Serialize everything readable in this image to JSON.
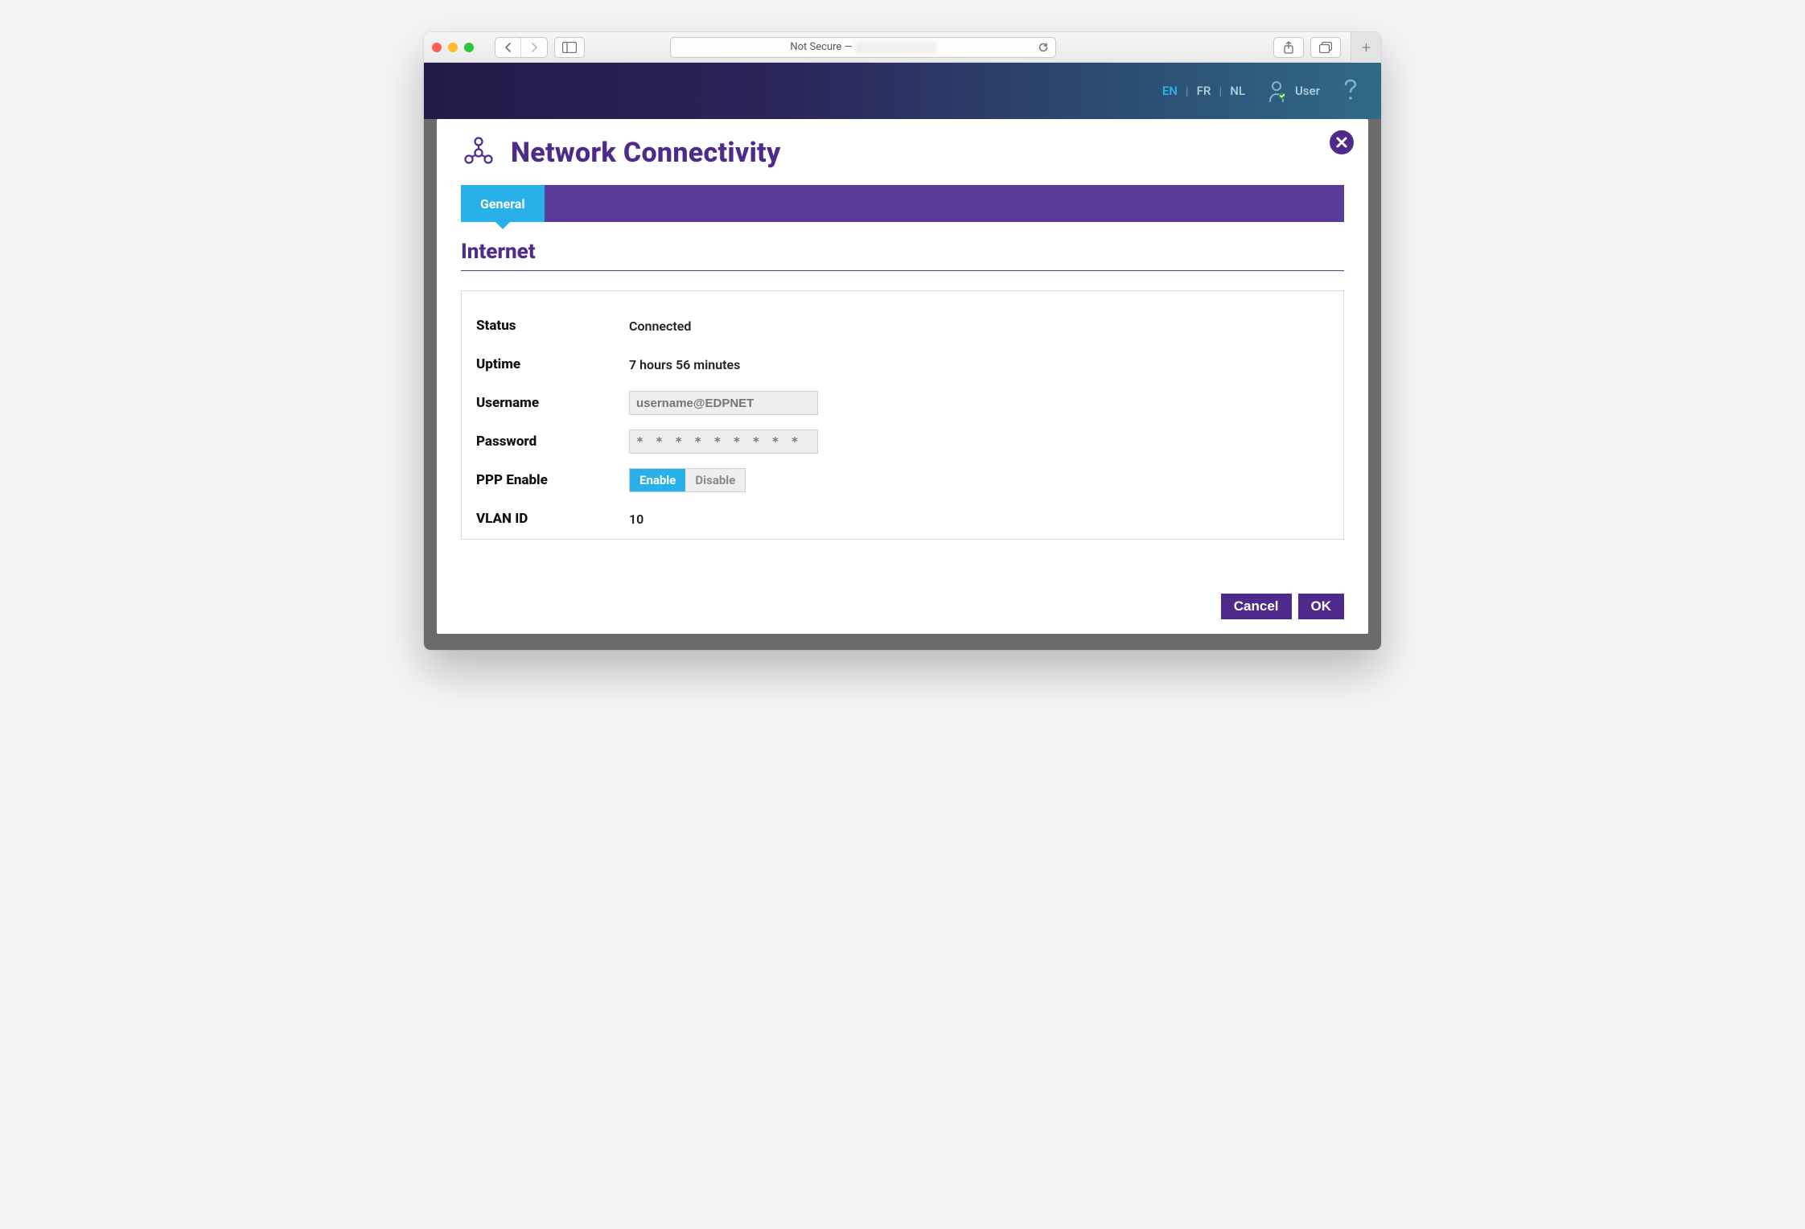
{
  "browser": {
    "url_prefix": "Not Secure — "
  },
  "appbar": {
    "langs": [
      "EN",
      "FR",
      "NL"
    ],
    "active_lang": "EN",
    "user_label": "User"
  },
  "modal": {
    "title": "Network Connectivity",
    "tabs": [
      {
        "label": "General",
        "active": true
      }
    ],
    "section_title": "Internet",
    "fields": {
      "status": {
        "label": "Status",
        "value": "Connected"
      },
      "uptime": {
        "label": "Uptime",
        "value": "7 hours 56 minutes"
      },
      "username": {
        "label": "Username",
        "placeholder": "username@EDPNET",
        "value": ""
      },
      "password": {
        "label": "Password",
        "value": "* * * * * * * * *"
      },
      "ppp_enable": {
        "label": "PPP Enable",
        "options": [
          "Enable",
          "Disable"
        ],
        "selected": "Enable"
      },
      "vlan_id": {
        "label": "VLAN ID",
        "value": "10"
      }
    },
    "actions": {
      "cancel": "Cancel",
      "ok": "OK"
    }
  }
}
